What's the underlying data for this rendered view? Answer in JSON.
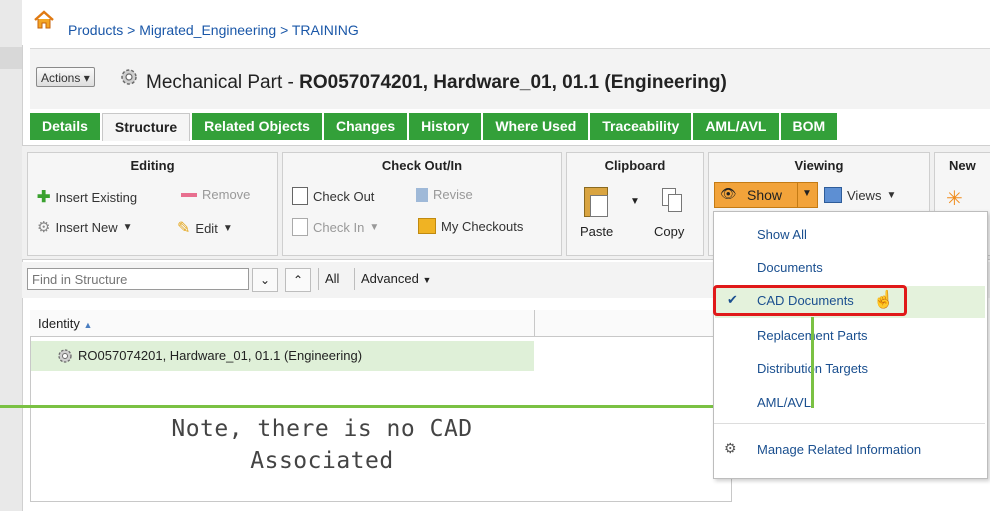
{
  "breadcrumb": "Products > Migrated_Engineering > TRAINING",
  "actions_label": "Actions",
  "title": {
    "prefix": "Mechanical Part - ",
    "bold": "RO057074201, Hardware_01, 01.1 (Engineering)"
  },
  "tabs": [
    {
      "label": "Details"
    },
    {
      "label": "Structure"
    },
    {
      "label": "Related Objects"
    },
    {
      "label": "Changes"
    },
    {
      "label": "History"
    },
    {
      "label": "Where Used"
    },
    {
      "label": "Traceability"
    },
    {
      "label": "AML/AVL"
    },
    {
      "label": "BOM"
    }
  ],
  "ribbon": {
    "editing": {
      "title": "Editing",
      "insert_existing": "Insert Existing",
      "remove": "Remove",
      "insert_new": "Insert New",
      "edit": "Edit"
    },
    "checkout": {
      "title": "Check Out/In",
      "check_out": "Check Out",
      "revise": "Revise",
      "check_in": "Check In",
      "my_checkouts": "My Checkouts"
    },
    "clipboard": {
      "title": "Clipboard",
      "paste": "Paste",
      "copy": "Copy"
    },
    "viewing": {
      "title": "Viewing",
      "show": "Show",
      "views": "Views"
    },
    "new": {
      "title": "New"
    }
  },
  "find": {
    "placeholder": "Find in Structure",
    "all": "All",
    "advanced": "Advanced"
  },
  "grid": {
    "column": "Identity",
    "rows": [
      {
        "label": "RO057074201, Hardware_01, 01.1 (Engineering)"
      }
    ]
  },
  "menu": {
    "items": [
      "Show All",
      "Documents",
      "CAD Documents",
      "Replacement Parts",
      "Distribution Targets",
      "AML/AVL",
      "Manage Related Information"
    ]
  },
  "annotation": {
    "line1": "Note, there is no CAD",
    "line2": "Associated"
  },
  "colors": {
    "tab_green": "#33a039",
    "highlight_red": "#e01919",
    "annotation_green": "#7ac143",
    "show_orange": "#f2a33a"
  }
}
